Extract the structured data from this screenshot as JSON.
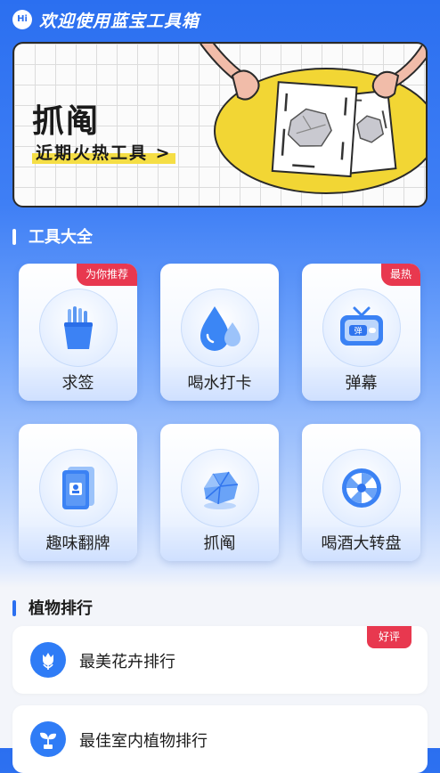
{
  "header": {
    "logo_text": "Hi",
    "title": "欢迎使用蓝宝工具箱"
  },
  "banner": {
    "title": "抓阄",
    "subtitle": "近期火热工具 >"
  },
  "tools_section": {
    "title": "工具大全",
    "items": [
      {
        "label": "求签",
        "icon": "fortune-sticks-icon",
        "tag": "为你推荐"
      },
      {
        "label": "喝水打卡",
        "icon": "water-drop-icon",
        "tag": ""
      },
      {
        "label": "弹幕",
        "icon": "tv-danmaku-icon",
        "tag": "最热",
        "icon_text": "弹"
      },
      {
        "label": "趣味翻牌",
        "icon": "playing-card-icon",
        "tag": ""
      },
      {
        "label": "抓阄",
        "icon": "paper-ball-icon",
        "tag": ""
      },
      {
        "label": "喝酒大转盘",
        "icon": "spin-wheel-icon",
        "tag": ""
      }
    ]
  },
  "plants_section": {
    "title": "植物排行",
    "items": [
      {
        "label": "最美花卉排行",
        "icon": "flower-icon",
        "tag": "好评"
      },
      {
        "label": "最佳室内植物排行",
        "icon": "sprout-icon",
        "tag": ""
      }
    ]
  },
  "colors": {
    "primary": "#2b6ff0",
    "tag_red": "#e8384f",
    "banner_yellow": "#f5de45"
  }
}
